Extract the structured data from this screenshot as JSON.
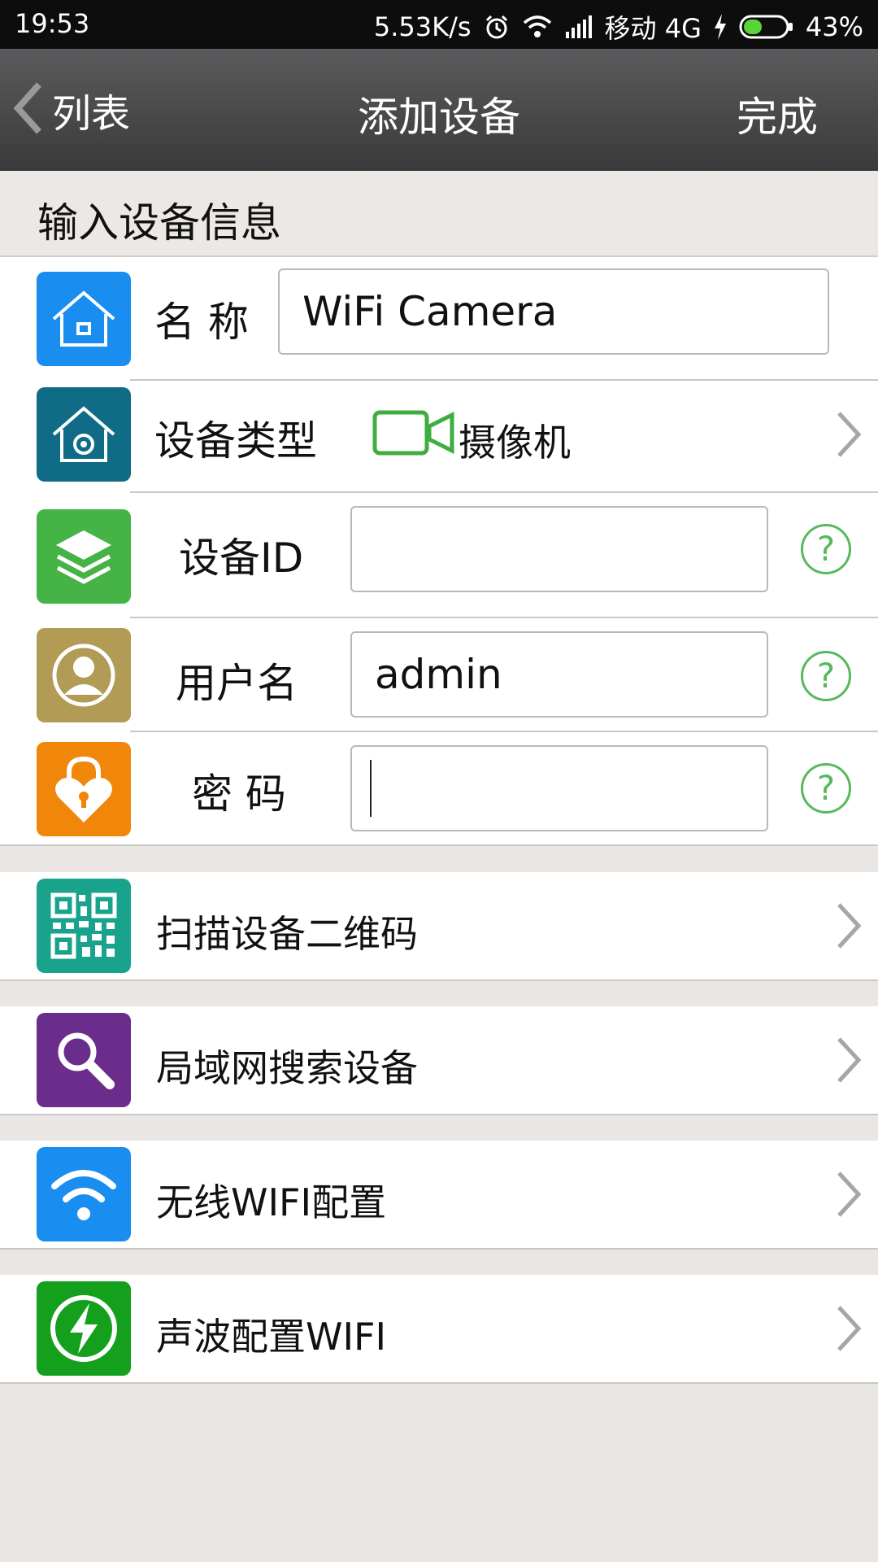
{
  "status_bar": {
    "time": "19:53",
    "speed": "5.53K/s",
    "carrier": "移动 4G",
    "battery_percent": "43%",
    "battery_level": 0.43,
    "icons": [
      "alarm-icon",
      "wifi-icon",
      "signal-icon",
      "charging-icon",
      "battery-icon"
    ]
  },
  "nav": {
    "back_label": "列表",
    "title": "添加设备",
    "done_label": "完成"
  },
  "section_title": "输入设备信息",
  "form": {
    "name_label": "名 称",
    "name_value": "WiFi Camera",
    "type_label": "设备类型",
    "type_value": "摄像机",
    "id_label": "设备ID",
    "id_value": "",
    "user_label": "用户名",
    "user_value": "admin",
    "password_label": "密 码",
    "password_value": "",
    "help_symbol": "?"
  },
  "actions": [
    {
      "label": "扫描设备二维码",
      "icon": "qr-code-icon",
      "color": "#1aa38c"
    },
    {
      "label": "局域网搜索设备",
      "icon": "magnifier-icon",
      "color": "#6b2d8b"
    },
    {
      "label": "无线WIFI配置",
      "icon": "wifi-icon",
      "color": "#1a8df0"
    },
    {
      "label": "声波配置WIFI",
      "icon": "lightning-icon",
      "color": "#14a01c"
    }
  ],
  "colors": {
    "name_tile": "#1a8df0",
    "type_tile": "#0f6b86",
    "id_tile": "#46b347",
    "user_tile": "#b29b55",
    "password_tile": "#f0860a",
    "help": "#57b95e"
  }
}
